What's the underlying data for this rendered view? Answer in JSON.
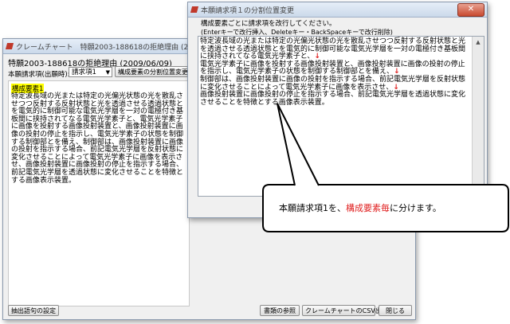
{
  "main_window": {
    "title": "クレームチャート　特願2003-188618の拒絶理由 (2009/06/09)",
    "heading": "特願2003-188618の拒絶理由 (2009/06/09)",
    "claim_label": "本願請求項(出願時):",
    "claim_select": "請求項1",
    "split_button": "構成要素の分割位置変更",
    "element_label": "構成要素1",
    "body_text": "特定波長域の光または特定の光偏光状態の光を散乱させつつ反射する反射状態と光を透過させる透過状態とを電気的に制御可能な電気光学層を一対の電極付き基板間に挟持されてなる電気光学素子と、電気光学素子に画像を投射する画像投射装置と、画像投射装置に画像の投射の停止を指示し、電気光学素子の状態を制御する制御部とを備え、制御部は、画像投射装置に画像の投射を指示する場合、前記電気光学層を反射状態に変化させることによって電気光学素子に画像を表示させ、画像投射装置に画像投射の停止を指示する場合、前記電気光学層を透過状態に変化させることを特徴とする画像表示装置。",
    "footer_buttons": {
      "extract": "抽出語句の設定",
      "reference": "書類の参照",
      "csv": "クレームチャートのCSV出力",
      "close": "閉じる"
    }
  },
  "dialog": {
    "title": "本願請求項１の分割位置変更",
    "instruction1": "構成要素ごとに請求項を改行してください。",
    "instruction2": "(Enterキーで改行挿入、Deleteキー・BackSpaceキーで改行削除)",
    "segments": [
      "特定波長域の光または特定の光偏光状態の光を散乱させつつ反射する反射状態と光を透過させる透過状態とを電気的に制御可能な電気光学層を一対の電極付き基板間に挟持されてなる電気光学素子と、",
      "電気光学素子に画像を投射する画像投射装置と、画像投射装置に画像の投射の停止を指示し、電気光学素子の状態を制御する制御部とを備え、",
      "制御部は、画像投射装置に画像の投射を指示する場合、前記電気光学層を反射状態に変化させることによって電気光学素子に画像を表示させ、",
      "画像投射装置に画像投射の停止を指示する場合、前記電気光学層を透過状態に変化させることを特徴とする画像表示装置。"
    ],
    "newline_mark": "↓"
  },
  "callout": {
    "text_before": "本願請求項1を、",
    "text_highlight": "構成要素毎",
    "text_after": "に分けます。",
    "highlight_color": "#e02020"
  }
}
